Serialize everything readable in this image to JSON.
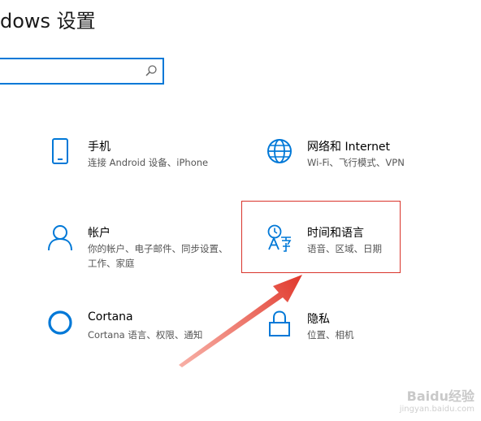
{
  "window": {
    "title": "dows 设置"
  },
  "search": {
    "value": "",
    "placeholder": ""
  },
  "tiles": [
    {
      "title": "手机",
      "subtitle": "连接 Android 设备、iPhone",
      "icon": "phone-icon"
    },
    {
      "title": "网络和 Internet",
      "subtitle": "Wi-Fi、飞行模式、VPN",
      "icon": "globe-icon"
    },
    {
      "title": "帐户",
      "subtitle": "你的帐户、电子邮件、同步设置、工作、家庭",
      "icon": "person-icon"
    },
    {
      "title": "时间和语言",
      "subtitle": "语音、区域、日期",
      "icon": "time-language-icon"
    },
    {
      "title": "Cortana",
      "subtitle": "Cortana 语言、权限、通知",
      "icon": "cortana-icon"
    },
    {
      "title": "隐私",
      "subtitle": "位置、相机",
      "icon": "lock-icon"
    }
  ],
  "watermark": {
    "text": "Baidu经验",
    "sub": "jingyan.baidu.com"
  },
  "colors": {
    "accent": "#0078d7",
    "highlight": "#d9342b"
  }
}
